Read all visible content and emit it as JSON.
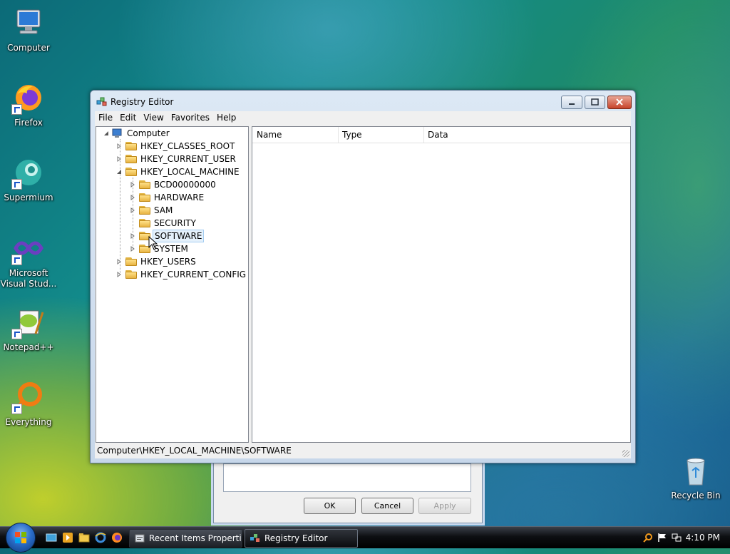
{
  "desktop": {
    "icons": [
      {
        "label": "Computer"
      },
      {
        "label": "Firefox"
      },
      {
        "label": "Supermium"
      },
      {
        "label": "Microsoft Visual Stud..."
      },
      {
        "label": "Notepad++"
      },
      {
        "label": "Everything"
      },
      {
        "label": "Recycle Bin"
      }
    ]
  },
  "back_dialog": {
    "ok_label": "OK",
    "cancel_label": "Cancel",
    "apply_label": "Apply"
  },
  "window": {
    "title": "Registry Editor",
    "icon": "registry-editor-icon",
    "menu": [
      "File",
      "Edit",
      "View",
      "Favorites",
      "Help"
    ],
    "tree": {
      "root": "Computer",
      "hives": [
        "HKEY_CLASSES_ROOT",
        "HKEY_CURRENT_USER",
        "HKEY_LOCAL_MACHINE",
        "HKEY_USERS",
        "HKEY_CURRENT_CONFIG"
      ],
      "hklm_children": [
        "BCD00000000",
        "HARDWARE",
        "SAM",
        "SECURITY",
        "SOFTWARE",
        "SYSTEM"
      ],
      "selected": "SOFTWARE"
    },
    "list_columns": [
      "Name",
      "Type",
      "Data"
    ],
    "status_path": "Computer\\HKEY_LOCAL_MACHINE\\SOFTWARE"
  },
  "taskbar": {
    "buttons": [
      {
        "label": "Recent Items Properti...",
        "icon": "properties-icon"
      },
      {
        "label": "Registry Editor",
        "icon": "registry-editor-icon",
        "active": true
      }
    ],
    "quick_launch": [
      "show-desktop-icon",
      "media-player-icon",
      "explorer-icon",
      "internet-explorer-icon",
      "firefox-icon"
    ],
    "clock": "4:10 PM"
  },
  "colors": {
    "selection_bg": "#e5f1fb",
    "selection_border": "#a5cdf1",
    "close_button": "#c7432a"
  }
}
